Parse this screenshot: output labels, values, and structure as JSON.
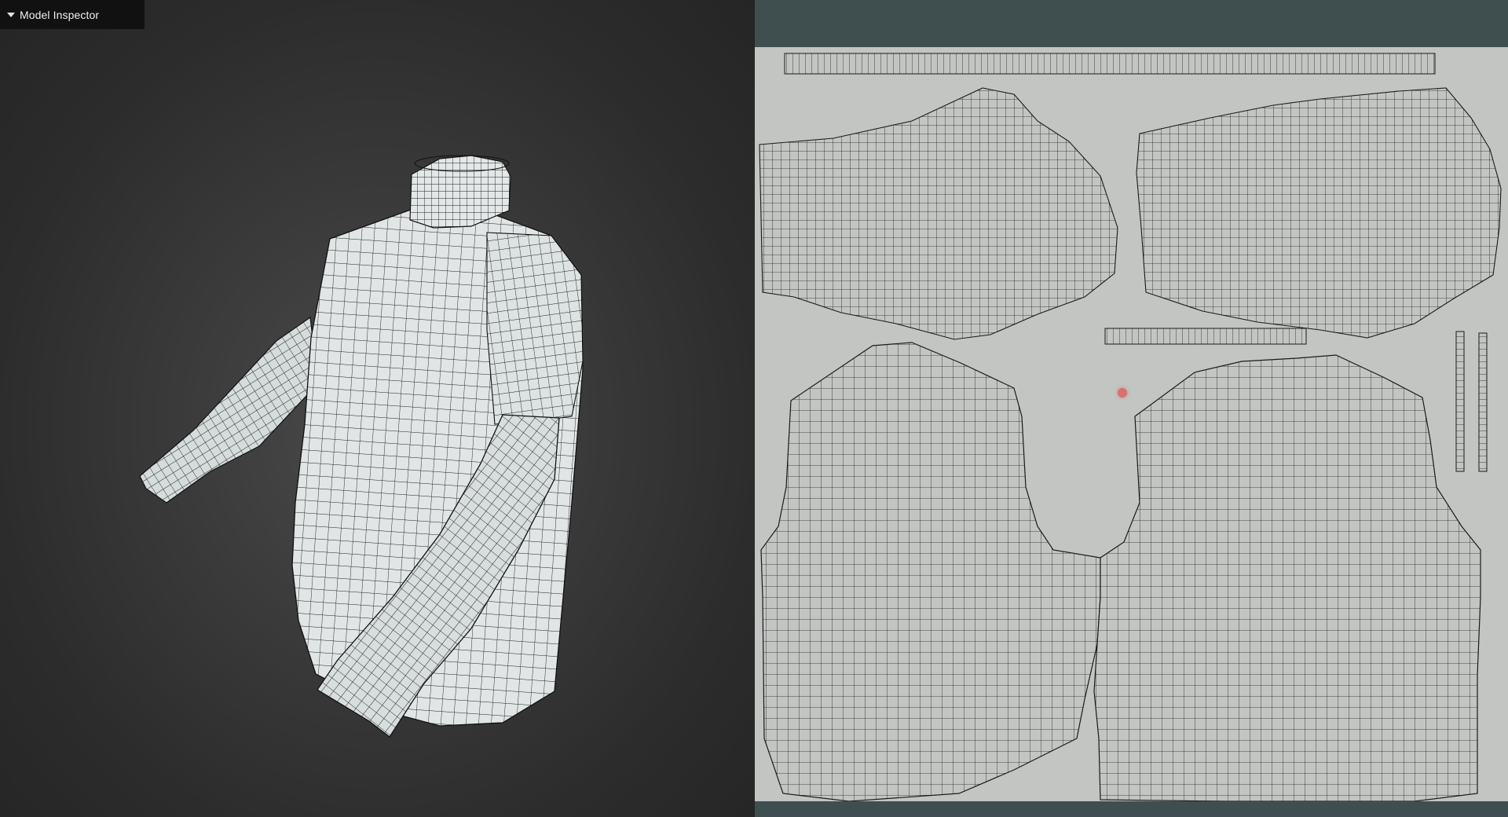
{
  "panel": {
    "title": "Model Inspector",
    "expanded": true,
    "caret_icon": "caret-down-icon"
  },
  "viewport": {
    "object": "shirt-mesh",
    "display_mode": "wireframe-over-solid"
  },
  "uv_editor": {
    "islands": [
      "sleeve-island-left",
      "sleeve-island-right",
      "front-body-island",
      "back-body-island",
      "collar-strip",
      "cuff-strip",
      "side-strip-left",
      "side-strip-right"
    ],
    "cursor": "uv-cursor-marker"
  },
  "colors": {
    "viewport_bg": "#333333",
    "mesh_fill": "#dfe3e3",
    "wire": "#1e1e1e",
    "uv_bg": "#c3c5c3",
    "uv_frame": "#3f4e4e",
    "cursor": "#d9706e"
  }
}
